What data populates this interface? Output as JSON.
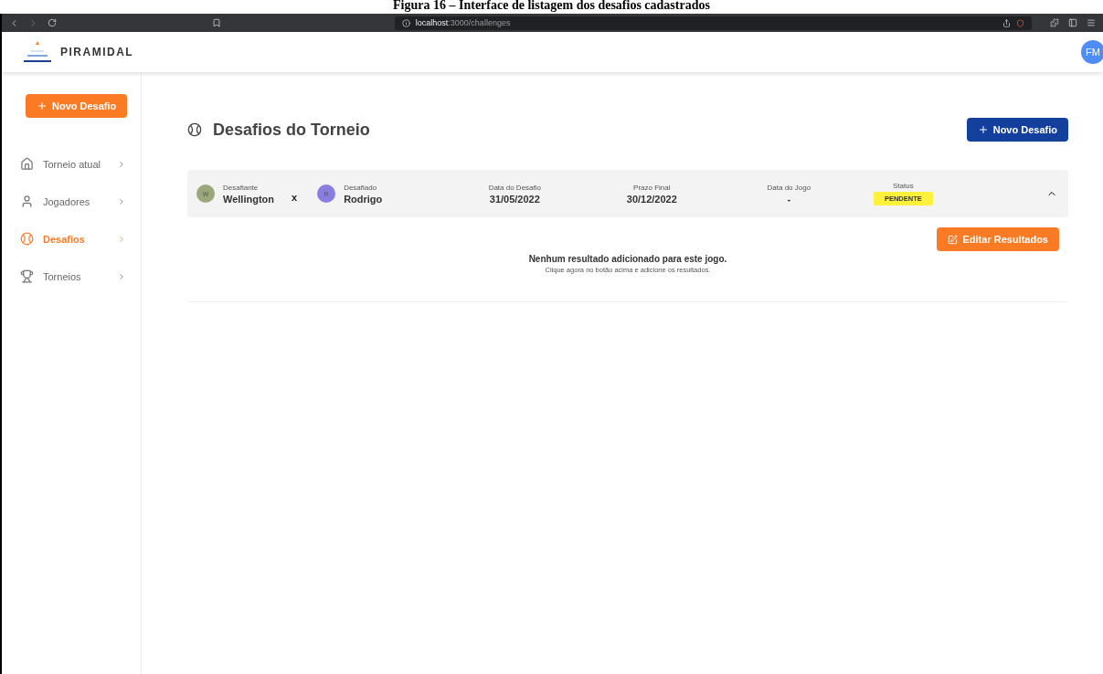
{
  "document": {
    "caption": "Figura 16 – Interface de listagem dos desafios cadastrados"
  },
  "browser": {
    "url_host": "localhost",
    "url_path": ":3000/challenges"
  },
  "header": {
    "brand": "PIRAMIDAL",
    "avatar": "FM"
  },
  "sidebar": {
    "new_button": "Novo Desafio",
    "items": [
      {
        "label": "Torneio atual",
        "kind": "home",
        "selected": false
      },
      {
        "label": "Jogadores",
        "kind": "user",
        "selected": false
      },
      {
        "label": "Desafios",
        "kind": "ball",
        "selected": true
      },
      {
        "label": "Torneios",
        "kind": "trophy",
        "selected": false
      }
    ]
  },
  "main": {
    "title": "Desafios do Torneio",
    "new_button": "Novo Desafio",
    "challenges": [
      {
        "challenger": {
          "label": "Desafiante",
          "name": "Wellington",
          "initial": "W",
          "color": "#9aa77a"
        },
        "versus": "x",
        "challenged": {
          "label": "Desafiado",
          "name": "Rodrigo",
          "initial": "R",
          "color": "#8a7de0"
        },
        "fields": [
          {
            "label": "Data do Desafio",
            "value": "31/05/2022"
          },
          {
            "label": "Prazo Final",
            "value": "30/12/2022"
          },
          {
            "label": "Data do Jogo",
            "value": "-"
          }
        ],
        "status_label": "Status",
        "status": "PENDENTE",
        "expanded": true,
        "edit_button": "Editar Resultados",
        "empty_title": "Nenhum resultado adicionado para este jogo.",
        "empty_hint": "Clique agora no botão acima e adicione os resultados."
      }
    ]
  }
}
